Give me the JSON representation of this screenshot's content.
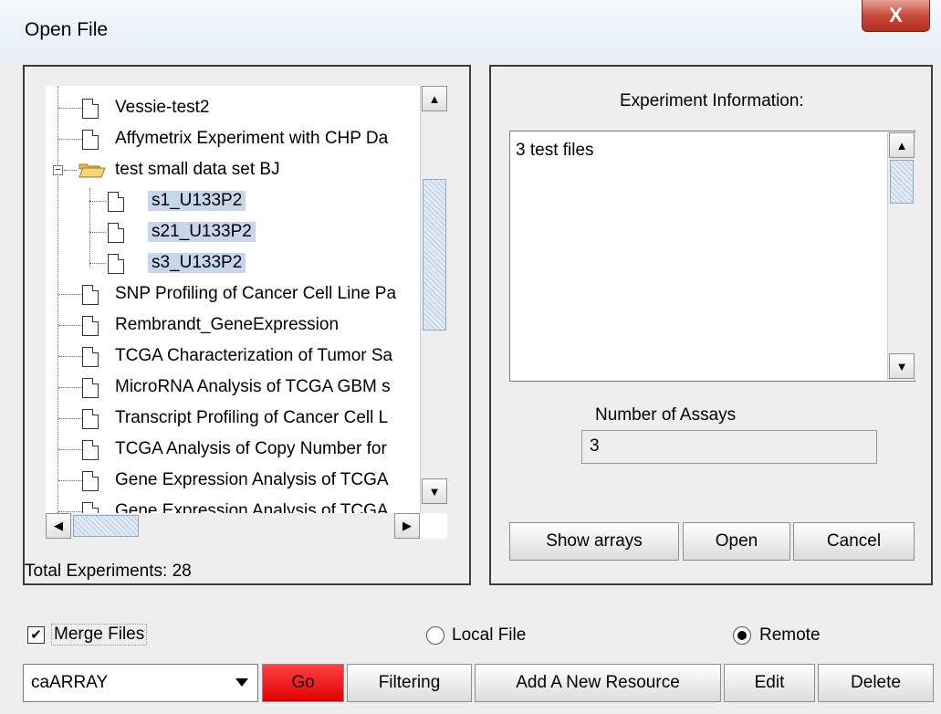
{
  "window": {
    "title": "Open File",
    "close_label": "X"
  },
  "tree": {
    "items": [
      {
        "label": "Vessie-test2",
        "type": "file",
        "selected": false
      },
      {
        "label": "Affymetrix Experiment with CHP Da",
        "type": "file",
        "selected": false
      },
      {
        "label": "test small data set BJ",
        "type": "folder",
        "expanded": true
      },
      {
        "label": "s1_U133P2",
        "type": "file",
        "selected": true,
        "child": true
      },
      {
        "label": "s21_U133P2",
        "type": "file",
        "selected": true,
        "child": true
      },
      {
        "label": "s3_U133P2",
        "type": "file",
        "selected": true,
        "child": true
      },
      {
        "label": "SNP Profiling of Cancer Cell Line Pa",
        "type": "file",
        "selected": false
      },
      {
        "label": "Rembrandt_GeneExpression",
        "type": "file",
        "selected": false
      },
      {
        "label": "TCGA Characterization of Tumor Sa",
        "type": "file",
        "selected": false
      },
      {
        "label": "MicroRNA  Analysis of TCGA GBM s",
        "type": "file",
        "selected": false
      },
      {
        "label": "Transcript Profiling of Cancer Cell L",
        "type": "file",
        "selected": false
      },
      {
        "label": "TCGA Analysis of Copy Number for",
        "type": "file",
        "selected": false
      },
      {
        "label": "Gene Expression Analysis of TCGA",
        "type": "file",
        "selected": false
      },
      {
        "label": "Gene Expression Analysis of TCGA",
        "type": "file",
        "selected": false
      }
    ]
  },
  "total_experiments": "Total Experiments: 28",
  "experiment_info": {
    "label": "Experiment Information:",
    "text": "3 test files"
  },
  "assays": {
    "label": "Number of Assays",
    "value": "3"
  },
  "buttons": {
    "show_arrays": "Show arrays",
    "open": "Open",
    "cancel": "Cancel",
    "go": "Go",
    "filtering": "Filtering",
    "add_resource": "Add A New Resource",
    "edit": "Edit",
    "delete": "Delete"
  },
  "options": {
    "merge_files": {
      "label": "Merge Files",
      "checked": true
    },
    "local_file": {
      "label": "Local File",
      "checked": false
    },
    "remote": {
      "label": "Remote",
      "checked": true
    }
  },
  "resource_select": {
    "value": "caARRAY"
  },
  "colors": {
    "selection": "#c6d7ec",
    "go_button": "#e00000",
    "close_button": "#c94a3a"
  }
}
